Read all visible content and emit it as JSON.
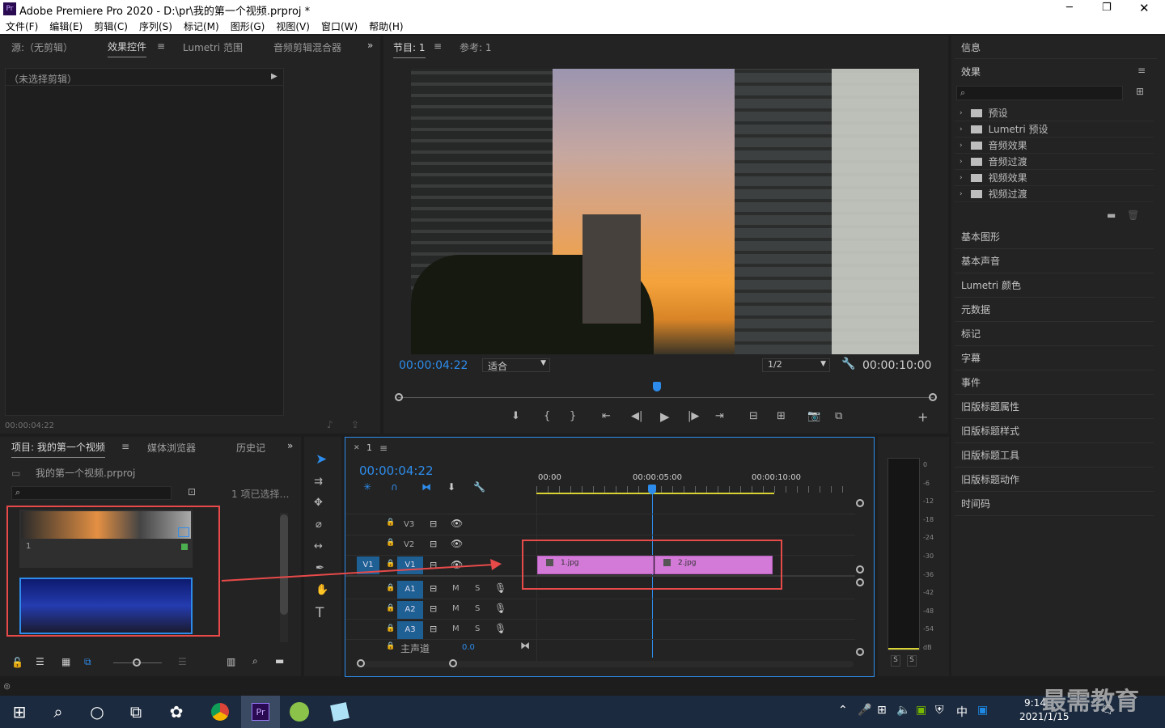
{
  "window": {
    "title": "Adobe Premiere Pro 2020 - D:\\pr\\我的第一个视频.prproj *",
    "app_badge": "Pr",
    "controls": [
      "─",
      "❐",
      "✕"
    ]
  },
  "menu": [
    "文件(F)",
    "编辑(E)",
    "剪辑(C)",
    "序列(S)",
    "标记(M)",
    "图形(G)",
    "视图(V)",
    "窗口(W)",
    "帮助(H)"
  ],
  "source_panel": {
    "tabs": [
      "源:（无剪辑）",
      "效果控件",
      "Lumetri 范围",
      "音频剪辑混合器"
    ],
    "active_tab": "效果控件",
    "no_clip": "（未选择剪辑）",
    "timecode": "00:00:04:22"
  },
  "program": {
    "tabs": [
      "节目: 1",
      "参考: 1"
    ],
    "timecode": "00:00:04:22",
    "fit": "适合",
    "resolution": "1/2",
    "duration": "00:00:10:00",
    "playhead_fraction": 0.484
  },
  "project": {
    "tabs": [
      "项目: 我的第一个视频",
      "媒体浏览器",
      "历史记"
    ],
    "file": "我的第一个视频.prproj",
    "selected": "1 项已选择…",
    "clip1_label": "1"
  },
  "timeline": {
    "tab": "1",
    "timecode": "00:00:04:22",
    "ruler": [
      "00:00",
      "00:00:05:00",
      "00:00:10:00"
    ],
    "video_tracks": [
      "V3",
      "V2",
      "V1"
    ],
    "source_patch": "V1",
    "audio_tracks": [
      "A1",
      "A2",
      "A3"
    ],
    "mix": {
      "label": "主声道",
      "value": "0.0"
    },
    "clips": [
      "1.jpg",
      "2.jpg"
    ],
    "track_buttons": {
      "mute": "M",
      "solo": "S"
    }
  },
  "meter": {
    "scale": [
      "0",
      "-6",
      "-12",
      "-18",
      "-24",
      "-30",
      "-36",
      "-42",
      "-48",
      "-54",
      "dB"
    ],
    "solo": [
      "S",
      "S"
    ]
  },
  "right": {
    "info": "信息",
    "effects_title": "效果",
    "effects": [
      "预设",
      "Lumetri 预设",
      "音频效果",
      "音频过渡",
      "视频效果",
      "视频过渡"
    ],
    "panels": [
      "基本图形",
      "基本声音",
      "Lumetri 颜色",
      "元数据",
      "标记",
      "字幕",
      "事件",
      "旧版标题属性",
      "旧版标题样式",
      "旧版标题工具",
      "旧版标题动作",
      "时间码"
    ]
  },
  "taskbar": {
    "time": "9:14",
    "date": "2021/1/15",
    "ime": "中",
    "watermark": "最需教育"
  },
  "colors": {
    "accent": "#2d8ceb",
    "clip": "#d37ad8",
    "highlight": "#e84a4a"
  }
}
